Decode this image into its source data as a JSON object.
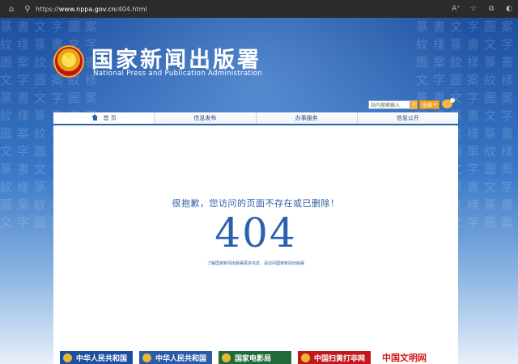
{
  "browser": {
    "url_prefix": "https://",
    "url_host": "www.nppa.gov.cn",
    "url_path": "/404.html"
  },
  "header": {
    "title": "国家新闻出版署",
    "subtitle": "National Press and Publication Administration"
  },
  "search": {
    "placeholder": "站内搜索输入",
    "scope_label": "全部"
  },
  "nav": {
    "tabs": [
      {
        "label": "首 页"
      },
      {
        "label": "信息发布"
      },
      {
        "label": "办事服务"
      },
      {
        "label": "信息公开"
      }
    ]
  },
  "error": {
    "message": "很抱歉，您访问的页面不存在或已删除！",
    "code": "404",
    "hint": "了解国家新闻出版署更多信息，请访问国家新闻出版署"
  },
  "links": [
    {
      "label": "中华人民共和国",
      "color": "#1d4fa0"
    },
    {
      "label": "中华人民共和国",
      "color": "#1d4fa0"
    },
    {
      "label": "国家电影局",
      "color": "#1f6a3a"
    },
    {
      "label": "中国扫黄打非网",
      "color": "#c2171d"
    },
    {
      "label": "中国文明网",
      "color": "#ffffff"
    }
  ],
  "colors": {
    "accent": "#2b5fb0",
    "nav_border": "#2d63ad"
  }
}
